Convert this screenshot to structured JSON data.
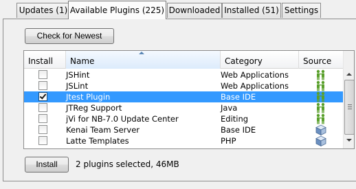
{
  "tabs": [
    {
      "label": "Updates (1)",
      "active": false
    },
    {
      "label": "Available Plugins (225)",
      "active": true
    },
    {
      "label": "Downloaded",
      "active": false
    },
    {
      "label": "Installed (51)",
      "active": false
    },
    {
      "label": "Settings",
      "active": false
    }
  ],
  "toolbar": {
    "check_label": "Check for Newest"
  },
  "table": {
    "columns": [
      "Install",
      "Name",
      "Category",
      "Source"
    ],
    "sorted_column": "Name",
    "rows": [
      {
        "name": "JSHint",
        "category": "Web Applications",
        "checked": false,
        "selected": false,
        "source_icon": "community-plugin-icon"
      },
      {
        "name": "JSLint",
        "category": "Web Applications",
        "checked": false,
        "selected": false,
        "source_icon": "community-plugin-icon"
      },
      {
        "name": "Jtest Plugin",
        "category": "Base IDE",
        "checked": true,
        "selected": true,
        "source_icon": "community-plugin-icon"
      },
      {
        "name": "JTReg Support",
        "category": "Java",
        "checked": false,
        "selected": false,
        "source_icon": "community-plugin-icon"
      },
      {
        "name": "jVi for NB-7.0 Update Center",
        "category": "Editing",
        "checked": false,
        "selected": false,
        "source_icon": "community-plugin-icon"
      },
      {
        "name": "Kenai Team Server",
        "category": "Base IDE",
        "checked": false,
        "selected": false,
        "source_icon": "cube-plugin-icon"
      },
      {
        "name": "Latte Templates",
        "category": "PHP",
        "checked": false,
        "selected": false,
        "source_icon": "cube-plugin-icon"
      }
    ]
  },
  "footer": {
    "install_label": "Install",
    "status_text": "2 plugins selected, 46MB"
  },
  "colors": {
    "selection": "#3399ff",
    "community_icon": "#5aa02c",
    "cube_icon": "#6a8fc0"
  }
}
